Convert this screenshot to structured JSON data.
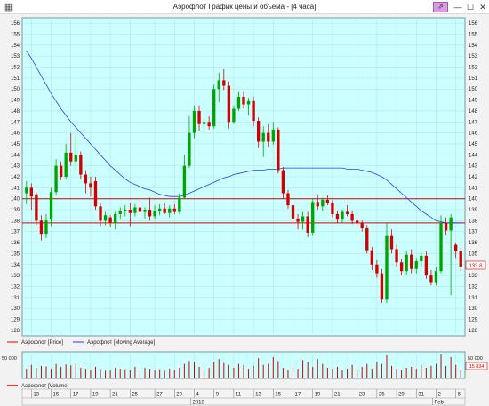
{
  "window": {
    "title": "Аэрофлот График цены и объёма - [4 часа]",
    "pin_icon": "pin-icon",
    "minimize_glyph": "—",
    "maximize_glyph": "☐",
    "close_glyph": "✕"
  },
  "colors": {
    "background": "#ccffff",
    "grid": "#9fdede",
    "bull": "#00a400",
    "bear": "#d40000",
    "moving_average": "#2a3ff0",
    "level_lines": "#d40000",
    "volume": "#d40000"
  },
  "legend": {
    "price": "Аэрофлот [Price]",
    "moving_average": "Аэрофлот [Moving Average]"
  },
  "volume_panel": {
    "legend": "Аэрофлот [Volume]",
    "left_tick": "50 000",
    "right_tick": "50 000",
    "last_value": "15 834"
  },
  "price_marker": "133.8",
  "chart_data": {
    "type": "candlestick",
    "y_ticks": [
      128,
      129,
      130,
      131,
      132,
      133,
      134,
      135,
      136,
      137,
      138,
      139,
      140,
      141,
      142,
      143,
      144,
      145,
      146,
      147,
      148,
      149,
      150,
      151,
      152,
      153,
      154,
      155,
      156
    ],
    "ylim": [
      127.5,
      156.5
    ],
    "x_tick_labels": [
      "13",
      "15",
      "17",
      "19",
      "21",
      "25",
      "27",
      "29",
      "4",
      "9",
      "11",
      "13",
      "15",
      "17",
      "19",
      "21",
      "23",
      "25",
      "29",
      "31",
      "2",
      "6"
    ],
    "x_secondary_labels": [
      "2018",
      "Feb"
    ],
    "horizontal_levels": [
      140.0,
      137.8
    ],
    "candles": [
      {
        "o": 140.5,
        "h": 141.6,
        "l": 139.5,
        "c": 141.0
      },
      {
        "o": 141.0,
        "h": 141.4,
        "l": 139.0,
        "c": 140.2
      },
      {
        "o": 140.4,
        "h": 140.6,
        "l": 137.6,
        "c": 138.0
      },
      {
        "o": 138.0,
        "h": 138.5,
        "l": 136.2,
        "c": 136.8
      },
      {
        "o": 136.8,
        "h": 138.6,
        "l": 136.4,
        "c": 138.0
      },
      {
        "o": 138.1,
        "h": 141.0,
        "l": 137.5,
        "c": 140.6
      },
      {
        "o": 140.6,
        "h": 143.6,
        "l": 140.3,
        "c": 143.0
      },
      {
        "o": 143.0,
        "h": 143.4,
        "l": 141.7,
        "c": 142.0
      },
      {
        "o": 142.0,
        "h": 145.0,
        "l": 141.8,
        "c": 144.2
      },
      {
        "o": 144.2,
        "h": 146.0,
        "l": 143.0,
        "c": 143.4
      },
      {
        "o": 143.4,
        "h": 145.8,
        "l": 142.6,
        "c": 144.0
      },
      {
        "o": 144.0,
        "h": 144.3,
        "l": 141.8,
        "c": 142.2
      },
      {
        "o": 142.2,
        "h": 142.6,
        "l": 140.5,
        "c": 141.4
      },
      {
        "o": 141.4,
        "h": 142.0,
        "l": 140.2,
        "c": 141.0
      },
      {
        "o": 141.6,
        "h": 142.0,
        "l": 139.0,
        "c": 139.3
      },
      {
        "o": 139.3,
        "h": 139.6,
        "l": 137.5,
        "c": 138.0
      },
      {
        "o": 138.0,
        "h": 138.8,
        "l": 137.6,
        "c": 138.5
      },
      {
        "o": 138.3,
        "h": 138.5,
        "l": 137.4,
        "c": 137.8
      },
      {
        "o": 137.8,
        "h": 138.8,
        "l": 137.2,
        "c": 138.6
      },
      {
        "o": 138.6,
        "h": 139.2,
        "l": 138.1,
        "c": 138.9
      },
      {
        "o": 138.9,
        "h": 139.4,
        "l": 138.4,
        "c": 139.0
      },
      {
        "o": 139.0,
        "h": 139.6,
        "l": 137.5,
        "c": 138.7
      },
      {
        "o": 138.7,
        "h": 139.5,
        "l": 138.4,
        "c": 139.2
      },
      {
        "o": 139.2,
        "h": 140.0,
        "l": 138.5,
        "c": 138.8
      },
      {
        "o": 138.8,
        "h": 139.2,
        "l": 138.2,
        "c": 139.0
      },
      {
        "o": 139.0,
        "h": 140.1,
        "l": 138.0,
        "c": 138.4
      },
      {
        "o": 138.4,
        "h": 139.4,
        "l": 138.1,
        "c": 138.9
      },
      {
        "o": 138.9,
        "h": 139.5,
        "l": 138.5,
        "c": 139.1
      },
      {
        "o": 139.1,
        "h": 139.6,
        "l": 138.6,
        "c": 138.7
      },
      {
        "o": 138.7,
        "h": 139.4,
        "l": 138.3,
        "c": 139.1
      },
      {
        "o": 139.1,
        "h": 139.5,
        "l": 138.6,
        "c": 138.8
      },
      {
        "o": 138.8,
        "h": 140.5,
        "l": 138.6,
        "c": 140.1
      },
      {
        "o": 140.1,
        "h": 144.0,
        "l": 140.0,
        "c": 143.0
      },
      {
        "o": 143.0,
        "h": 147.5,
        "l": 142.8,
        "c": 146.0
      },
      {
        "o": 146.0,
        "h": 148.5,
        "l": 145.5,
        "c": 148.0
      },
      {
        "o": 148.0,
        "h": 148.5,
        "l": 146.2,
        "c": 146.8
      },
      {
        "o": 146.8,
        "h": 147.4,
        "l": 146.4,
        "c": 147.0
      },
      {
        "o": 147.0,
        "h": 147.5,
        "l": 146.3,
        "c": 146.6
      },
      {
        "o": 146.6,
        "h": 150.4,
        "l": 146.4,
        "c": 150.0
      },
      {
        "o": 150.0,
        "h": 151.5,
        "l": 148.8,
        "c": 150.8
      },
      {
        "o": 150.8,
        "h": 151.8,
        "l": 149.9,
        "c": 150.3
      },
      {
        "o": 150.3,
        "h": 150.7,
        "l": 146.4,
        "c": 147.0
      },
      {
        "o": 147.0,
        "h": 148.5,
        "l": 146.8,
        "c": 148.2
      },
      {
        "o": 148.2,
        "h": 149.8,
        "l": 148.0,
        "c": 149.3
      },
      {
        "o": 149.3,
        "h": 149.8,
        "l": 148.2,
        "c": 148.6
      },
      {
        "o": 148.6,
        "h": 149.2,
        "l": 147.6,
        "c": 148.9
      },
      {
        "o": 148.9,
        "h": 149.3,
        "l": 146.6,
        "c": 147.1
      },
      {
        "o": 147.1,
        "h": 147.4,
        "l": 144.6,
        "c": 145.2
      },
      {
        "o": 145.2,
        "h": 146.6,
        "l": 143.8,
        "c": 146.0
      },
      {
        "o": 146.0,
        "h": 146.8,
        "l": 144.7,
        "c": 145.2
      },
      {
        "o": 145.2,
        "h": 147.0,
        "l": 144.9,
        "c": 146.3
      },
      {
        "o": 146.3,
        "h": 146.5,
        "l": 142.3,
        "c": 142.6
      },
      {
        "o": 142.6,
        "h": 142.9,
        "l": 140.0,
        "c": 140.5
      },
      {
        "o": 140.5,
        "h": 140.8,
        "l": 139.1,
        "c": 139.4
      },
      {
        "o": 139.4,
        "h": 139.6,
        "l": 137.5,
        "c": 138.2
      },
      {
        "o": 138.2,
        "h": 138.6,
        "l": 137.2,
        "c": 137.9
      },
      {
        "o": 137.9,
        "h": 138.8,
        "l": 137.2,
        "c": 138.4
      },
      {
        "o": 138.4,
        "h": 138.8,
        "l": 136.5,
        "c": 136.9
      },
      {
        "o": 136.9,
        "h": 140.0,
        "l": 136.6,
        "c": 139.7
      },
      {
        "o": 139.7,
        "h": 140.4,
        "l": 139.0,
        "c": 139.3
      },
      {
        "o": 139.3,
        "h": 140.1,
        "l": 138.9,
        "c": 139.9
      },
      {
        "o": 139.9,
        "h": 140.3,
        "l": 139.4,
        "c": 139.6
      },
      {
        "o": 139.6,
        "h": 139.9,
        "l": 138.3,
        "c": 138.6
      },
      {
        "o": 138.6,
        "h": 138.9,
        "l": 137.8,
        "c": 138.1
      },
      {
        "o": 138.1,
        "h": 139.0,
        "l": 137.8,
        "c": 138.8
      },
      {
        "o": 138.8,
        "h": 139.4,
        "l": 138.4,
        "c": 138.6
      },
      {
        "o": 138.6,
        "h": 138.9,
        "l": 137.7,
        "c": 138.0
      },
      {
        "o": 138.0,
        "h": 138.3,
        "l": 137.5,
        "c": 137.8
      },
      {
        "o": 137.8,
        "h": 138.0,
        "l": 137.0,
        "c": 137.3
      },
      {
        "o": 137.3,
        "h": 137.6,
        "l": 135.0,
        "c": 135.3
      },
      {
        "o": 135.3,
        "h": 135.6,
        "l": 133.5,
        "c": 134.0
      },
      {
        "o": 134.0,
        "h": 134.4,
        "l": 132.8,
        "c": 133.2
      },
      {
        "o": 133.2,
        "h": 133.6,
        "l": 130.5,
        "c": 130.8
      },
      {
        "o": 130.8,
        "h": 137.8,
        "l": 130.5,
        "c": 136.6
      },
      {
        "o": 136.6,
        "h": 137.2,
        "l": 135.0,
        "c": 135.4
      },
      {
        "o": 135.4,
        "h": 135.8,
        "l": 133.8,
        "c": 134.2
      },
      {
        "o": 134.2,
        "h": 134.5,
        "l": 133.0,
        "c": 133.4
      },
      {
        "o": 133.4,
        "h": 135.2,
        "l": 133.1,
        "c": 134.9
      },
      {
        "o": 134.9,
        "h": 135.4,
        "l": 133.2,
        "c": 133.6
      },
      {
        "o": 133.6,
        "h": 134.6,
        "l": 133.2,
        "c": 134.3
      },
      {
        "o": 134.3,
        "h": 135.1,
        "l": 133.8,
        "c": 134.8
      },
      {
        "o": 134.8,
        "h": 135.2,
        "l": 132.7,
        "c": 133.0
      },
      {
        "o": 133.0,
        "h": 133.5,
        "l": 132.1,
        "c": 132.4
      },
      {
        "o": 132.4,
        "h": 133.8,
        "l": 132.1,
        "c": 133.4
      },
      {
        "o": 133.4,
        "h": 138.5,
        "l": 133.2,
        "c": 137.8
      },
      {
        "o": 137.8,
        "h": 138.3,
        "l": 136.7,
        "c": 137.1
      },
      {
        "o": 137.1,
        "h": 138.6,
        "l": 131.2,
        "c": 138.3
      },
      {
        "o": 135.8,
        "h": 136.0,
        "l": 134.6,
        "c": 135.2
      },
      {
        "o": 135.2,
        "h": 135.5,
        "l": 133.4,
        "c": 133.8
      }
    ],
    "moving_average": [
      153.5,
      152.8,
      152.0,
      151.2,
      150.4,
      149.6,
      148.9,
      148.2,
      147.6,
      147.0,
      146.5,
      146.0,
      145.5,
      145.0,
      144.5,
      144.0,
      143.5,
      143.0,
      142.6,
      142.2,
      141.8,
      141.5,
      141.3,
      141.1,
      140.9,
      140.8,
      140.6,
      140.4,
      140.3,
      140.2,
      140.2,
      140.2,
      140.3,
      140.5,
      140.7,
      140.9,
      141.1,
      141.3,
      141.5,
      141.7,
      141.9,
      142.0,
      142.2,
      142.3,
      142.4,
      142.5,
      142.6,
      142.6,
      142.6,
      142.7,
      142.7,
      142.7,
      142.8,
      142.8,
      142.8,
      142.8,
      142.8,
      142.8,
      142.8,
      142.8,
      142.8,
      142.8,
      142.8,
      142.8,
      142.8,
      142.7,
      142.7,
      142.7,
      142.6,
      142.5,
      142.4,
      142.2,
      142.0,
      141.7,
      141.3,
      140.9,
      140.5,
      140.1,
      139.7,
      139.3,
      138.9,
      138.6,
      138.3,
      138.0,
      137.9,
      137.8,
      137.8,
      137.8,
      137.8
    ],
    "volume": [
      20,
      28,
      22,
      26,
      25,
      20,
      30,
      24,
      29,
      27,
      30,
      22,
      20,
      18,
      24,
      20,
      16,
      18,
      22,
      20,
      19,
      17,
      24,
      18,
      22,
      20,
      17,
      19,
      16,
      20,
      18,
      22,
      30,
      36,
      34,
      24,
      20,
      22,
      34,
      40,
      32,
      28,
      22,
      30,
      28,
      20,
      26,
      42,
      28,
      30,
      44,
      36,
      22,
      18,
      28,
      20,
      38,
      34,
      24,
      40,
      30,
      22,
      20,
      24,
      18,
      20,
      28,
      16,
      24,
      30,
      20,
      34,
      30,
      48,
      26,
      20,
      18,
      22,
      24,
      20,
      28,
      22,
      26,
      30,
      50,
      26,
      44,
      28,
      18
    ]
  }
}
